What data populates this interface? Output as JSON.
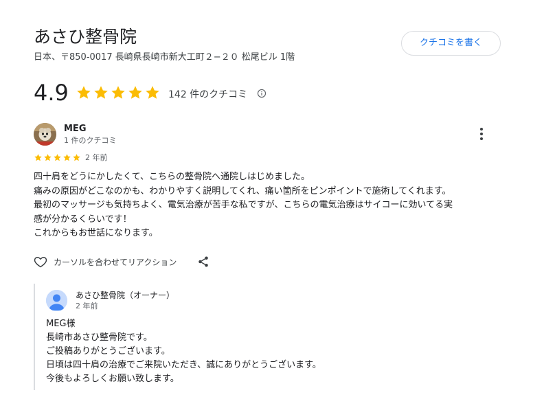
{
  "business": {
    "name": "あさひ整骨院",
    "address": "日本、〒850-0017 長崎県長崎市新大工町２−２０ 松尾ビル 1階",
    "write_review_label": "クチコミを書く",
    "rating": "4.9",
    "rating_stars": 5,
    "review_count_label": "142 件のクチコミ"
  },
  "review": {
    "author": "MEG",
    "author_meta": "1 件のクチコミ",
    "stars": 5,
    "date": "2 年前",
    "lines": [
      "四十肩をどうにかしたくて、こちらの整骨院へ通院しはじめました。",
      "痛みの原因がどこなのかも、わかりやすく説明してくれ、痛い箇所をピンポイントで施術してくれます。",
      "最初のマッサージも気持ちよく、電気治療が苦手な私ですが、こちらの電気治療はサイコーに効いてる実",
      "感が分かるくらいです！",
      "これからもお世話になります。"
    ],
    "reaction_label": "カーソルを合わせてリアクション"
  },
  "owner_reply": {
    "name": "あさひ整骨院（オーナー）",
    "date": "2 年前",
    "lines": [
      "MEG様",
      "長崎市あさひ整骨院です。",
      "ご投稿ありがとうございます。",
      "日頃は四十肩の治療でご来院いただき、誠にありがとうございます。",
      "今後もよろしくお願い致します。"
    ]
  },
  "icons": {
    "star": "star-icon",
    "info": "info-icon",
    "more": "more-vert-icon",
    "heart": "heart-outline-icon",
    "share": "share-icon"
  },
  "colors": {
    "star": "#fbbc04",
    "link": "#1a73e8",
    "muted": "#5f6368"
  }
}
